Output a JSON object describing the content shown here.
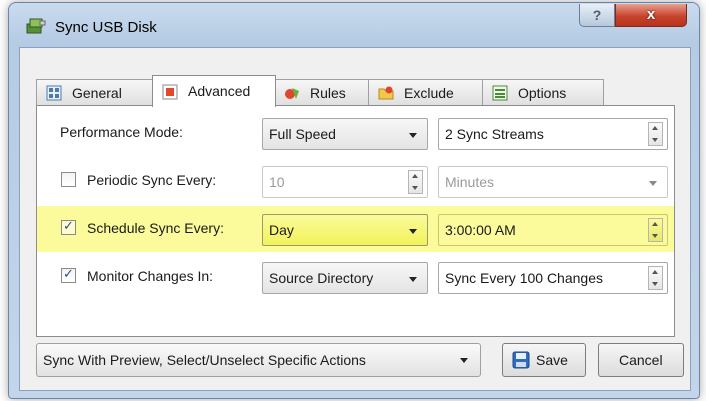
{
  "window": {
    "title": "Sync USB Disk",
    "help_glyph": "?",
    "close_glyph": "x"
  },
  "tabs": [
    {
      "label": "General",
      "icon": "general-icon",
      "active": false
    },
    {
      "label": "Advanced",
      "icon": "advanced-icon",
      "active": true
    },
    {
      "label": "Rules",
      "icon": "rules-icon",
      "active": false
    },
    {
      "label": "Exclude",
      "icon": "exclude-icon",
      "active": false
    },
    {
      "label": "Options",
      "icon": "options-icon",
      "active": false
    }
  ],
  "rows": {
    "performance": {
      "label": "Performance Mode:",
      "mode": "Full Speed",
      "streams": "2 Sync Streams"
    },
    "periodic": {
      "label": "Periodic Sync Every:",
      "checked": false,
      "value": "10",
      "unit": "Minutes"
    },
    "schedule": {
      "label": "Schedule Sync Every:",
      "checked": true,
      "period": "Day",
      "time": "3:00:00 AM"
    },
    "monitor": {
      "label": "Monitor Changes In:",
      "checked": true,
      "source": "Source Directory",
      "changes": "Sync Every 100 Changes"
    }
  },
  "bottom": {
    "mode": "Sync With Preview, Select/Unselect Specific Actions",
    "save": "Save",
    "cancel": "Cancel"
  },
  "colors": {
    "highlight": "#fbfb9b",
    "title_bar": "#c3d5ea",
    "close": "#c8452d"
  }
}
